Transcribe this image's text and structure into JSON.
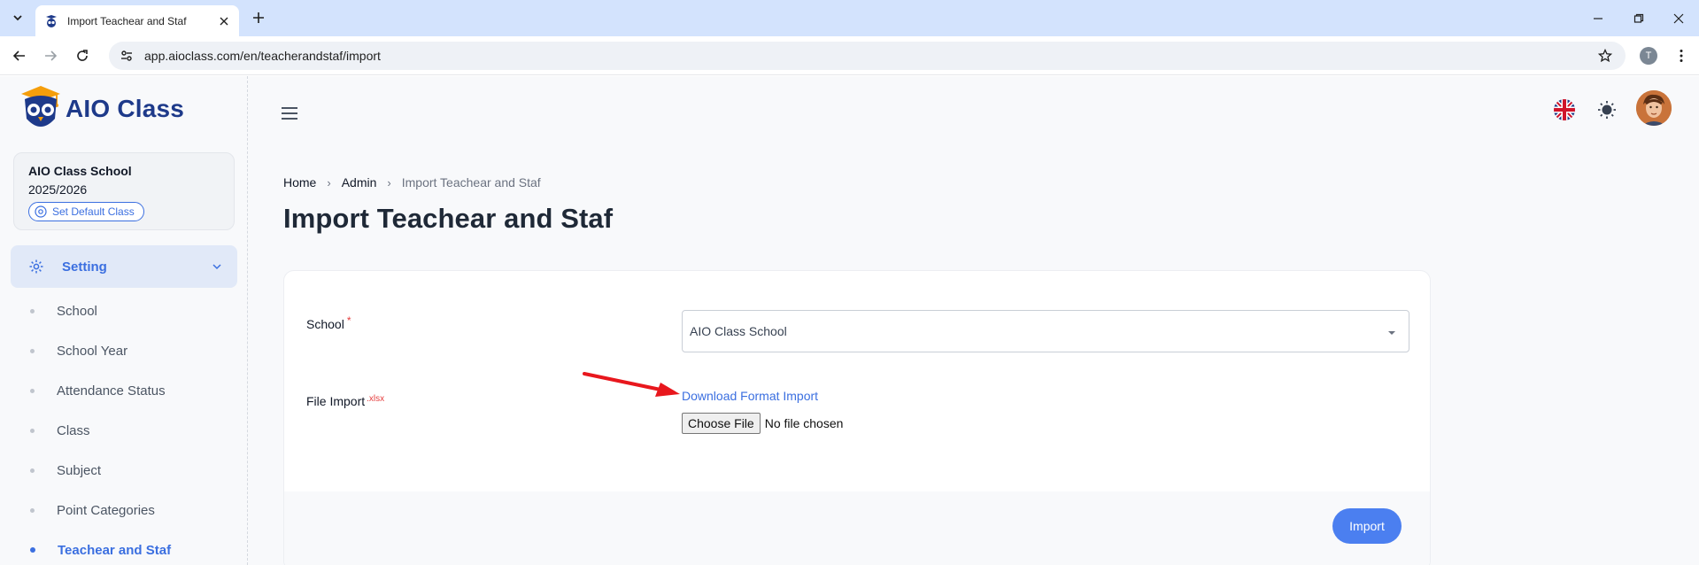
{
  "browser": {
    "tab_title": "Import Teachear and Staf",
    "url": "app.aioclass.com/en/teacherandstaf/import",
    "profile_initial": "T"
  },
  "app": {
    "brand_name": "AIO Class",
    "school": {
      "name": "AIO Class School",
      "year": "2025/2026",
      "set_default_label": "Set Default Class"
    },
    "menu": {
      "group_label": "Setting",
      "items": [
        {
          "label": "School",
          "active": false
        },
        {
          "label": "School Year",
          "active": false
        },
        {
          "label": "Attendance Status",
          "active": false
        },
        {
          "label": "Class",
          "active": false
        },
        {
          "label": "Subject",
          "active": false
        },
        {
          "label": "Point Categories",
          "active": false
        },
        {
          "label": "Teachear and Staf",
          "active": true
        }
      ]
    },
    "breadcrumb": [
      "Home",
      "Admin",
      "Import Teachear and Staf"
    ],
    "page_title": "Import Teachear and Staf",
    "form": {
      "school_label": "School",
      "required_mark": "*",
      "school_value": "AIO Class School",
      "file_label": "File Import",
      "file_ext": ".xlsx",
      "download_link": "Download Format Import",
      "choose_file": "Choose File",
      "no_file": "No file chosen",
      "import_button": "Import"
    },
    "colors": {
      "accent": "#3b6fe0",
      "brand": "#1e3a8a",
      "required": "#e53e3e",
      "annotation_arrow": "#e8171d"
    }
  }
}
